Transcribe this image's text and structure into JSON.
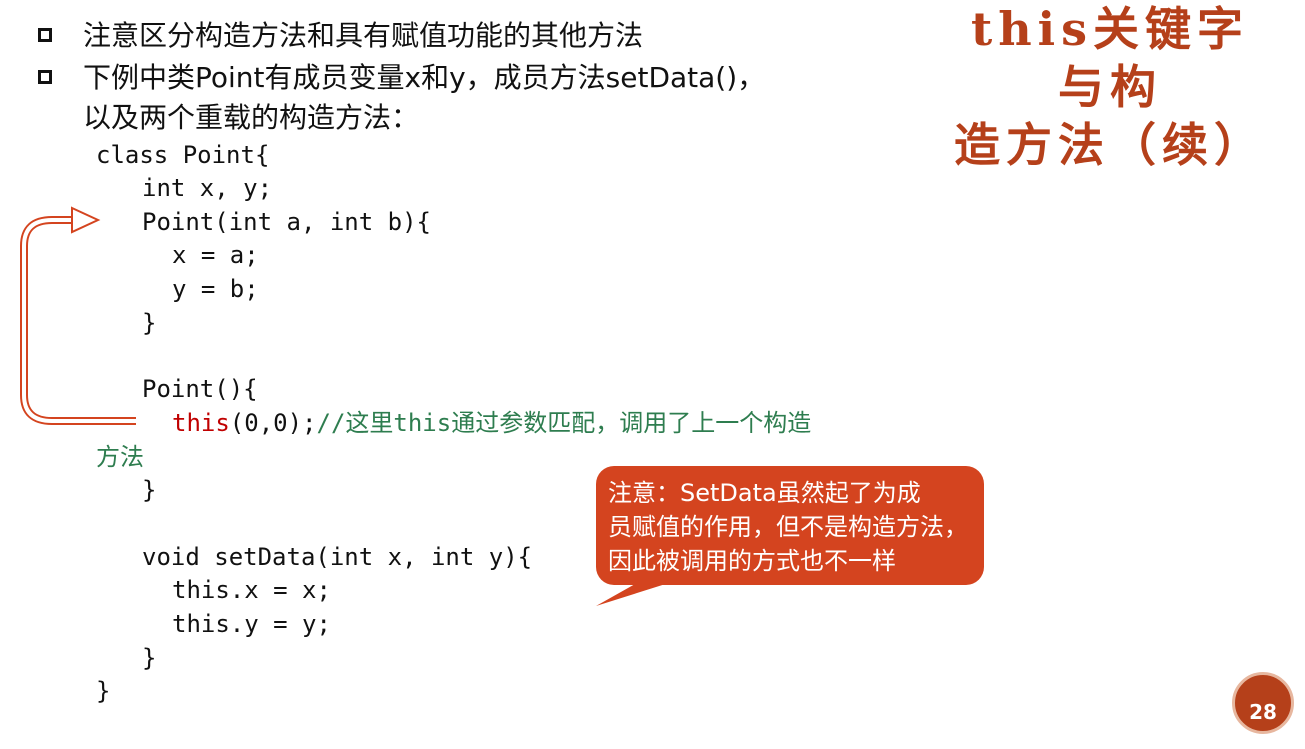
{
  "title": {
    "line1": "this关键字与构",
    "line2": "造方法（续）"
  },
  "bullets": {
    "b1": "注意区分构造方法和具有赋值功能的其他方法",
    "b2_line1": "下例中类Point有成员变量x和y，成员方法setData()，",
    "b2_line2": "以及两个重载的构造方法："
  },
  "code": {
    "l1": "class Point{",
    "l2": "int x, y;",
    "l3": "Point(int a, int b){",
    "l4": "x = a;",
    "l5": "y = b;",
    "l6": "}",
    "l7": "Point(){",
    "l8_kw": "this",
    "l8_args": "(0,0);",
    "l8_comment": "//这里this通过参数匹配，调用了上一个构造",
    "l9_comment": "方法",
    "l10": "}",
    "l11": "void setData(int x, int y){",
    "l12": "this.x = x;",
    "l13": "this.y = y;",
    "l14": "}",
    "l15": "}"
  },
  "callout": {
    "line1": "注意：SetData虽然起了为成",
    "line2": "员赋值的作用，但不是构造方法，",
    "line3": "因此被调用的方式也不一样"
  },
  "page_number": "28",
  "colors": {
    "accent": "#b5401a",
    "callout": "#d4441f",
    "keyword": "#c00000",
    "comment": "#2e7d4f"
  }
}
